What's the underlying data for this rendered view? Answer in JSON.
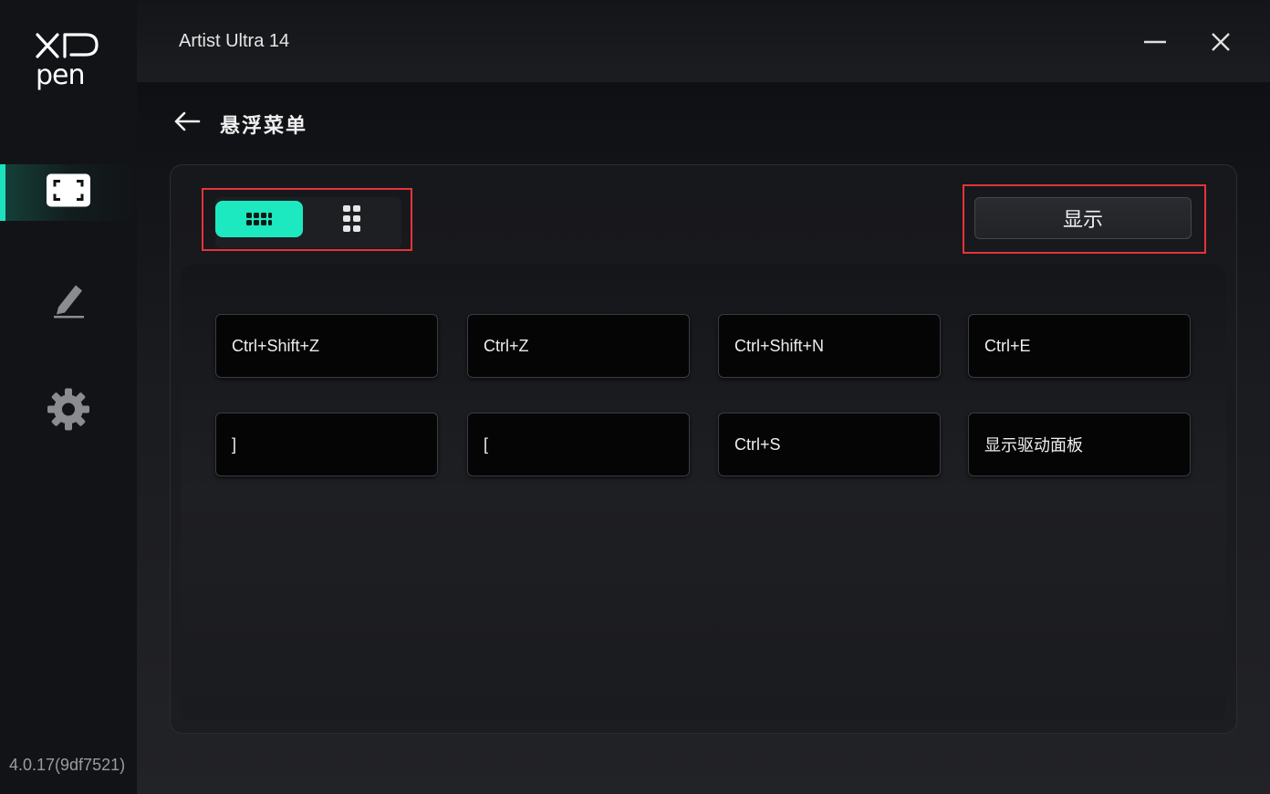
{
  "app": {
    "logo_text_top": "XP",
    "logo_text_bottom": "pen",
    "version": "4.0.17(9df7521)",
    "title": "Artist Ultra 14"
  },
  "sidebar": {
    "items": [
      {
        "name": "display-mapping",
        "icon": "screen-frame-icon",
        "active": true
      },
      {
        "name": "pen-settings",
        "icon": "pen-icon",
        "active": false
      },
      {
        "name": "settings",
        "icon": "gear-icon",
        "active": false
      }
    ]
  },
  "page": {
    "title": "悬浮菜单",
    "back_icon": "left-arrow-icon"
  },
  "layout_toggle": {
    "options": [
      {
        "icon": "horizontal-grid-icon",
        "selected": true
      },
      {
        "icon": "vertical-grid-icon",
        "selected": false
      }
    ]
  },
  "show_button": {
    "label": "显示"
  },
  "keys": [
    {
      "label": "Ctrl+Shift+Z"
    },
    {
      "label": "Ctrl+Z"
    },
    {
      "label": "Ctrl+Shift+N"
    },
    {
      "label": "Ctrl+E"
    },
    {
      "label": "]"
    },
    {
      "label": "["
    },
    {
      "label": "Ctrl+S"
    },
    {
      "label": "显示驱动面板"
    }
  ],
  "colors": {
    "accent": "#1de9c0",
    "highlight": "#e5333a",
    "background": "#1b1c1f"
  }
}
